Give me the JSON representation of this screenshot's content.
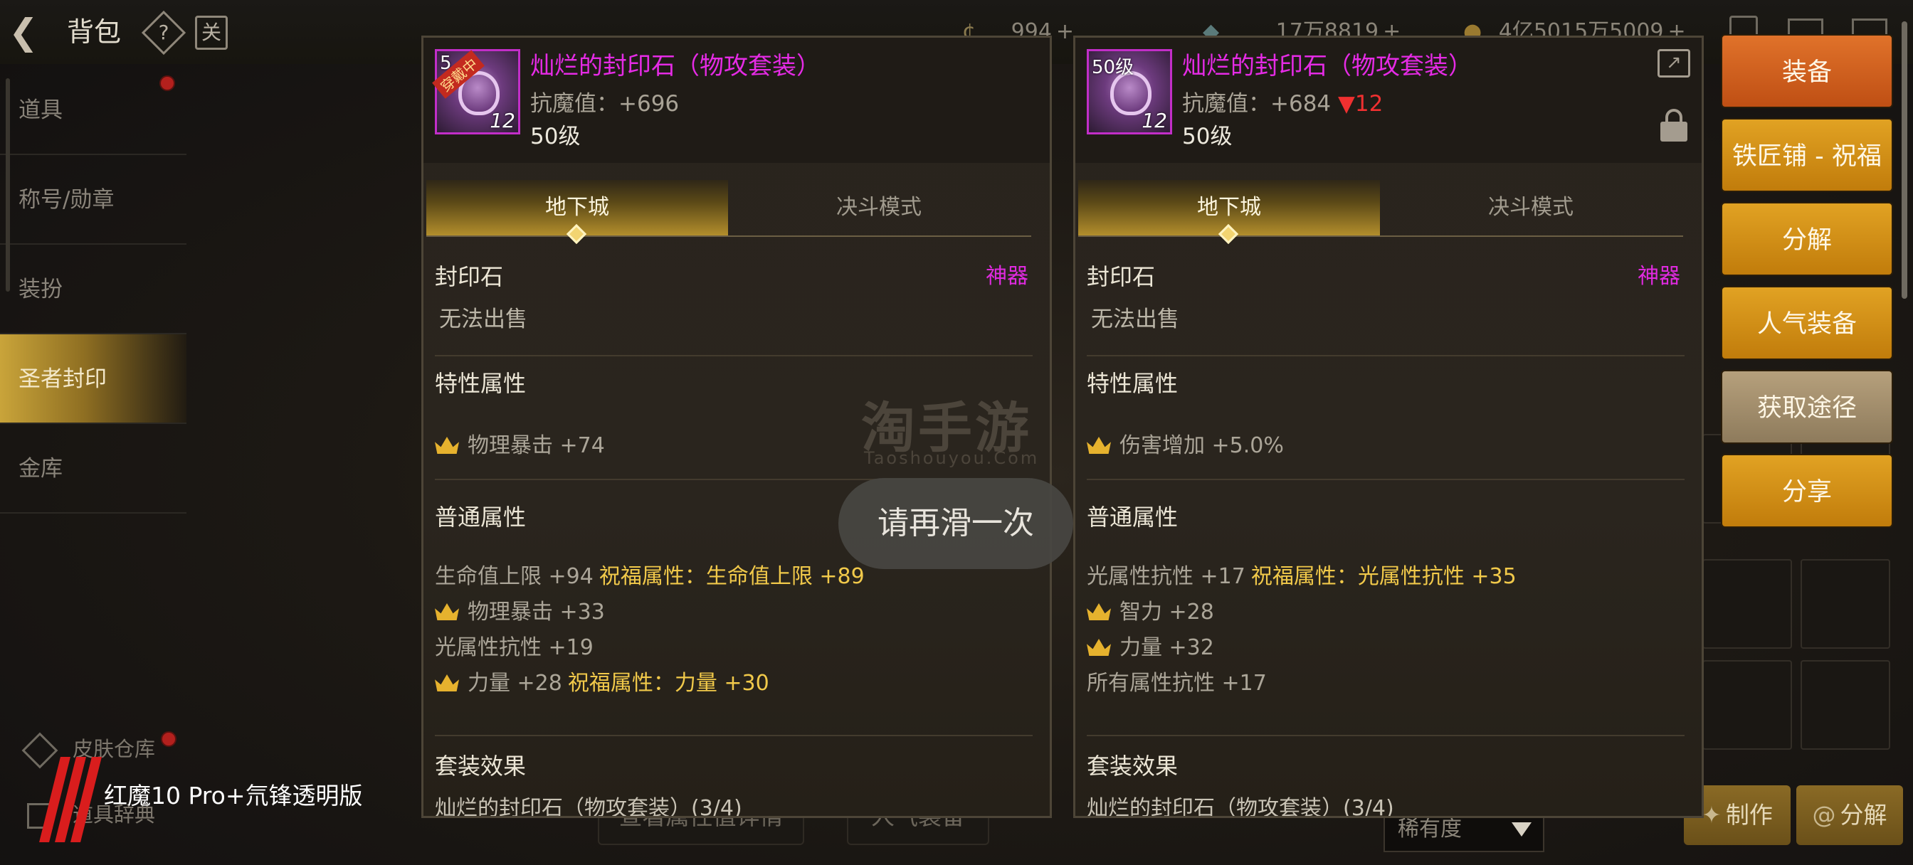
{
  "header": {
    "title": "背包",
    "help_glyph": "?",
    "calendar_glyph": "关",
    "currencies": [
      {
        "icon": "coin-icon",
        "value": "994"
      },
      {
        "icon": "gem-icon",
        "value": "17万8819"
      },
      {
        "icon": "gold-icon",
        "value": "4亿5015万5009"
      }
    ],
    "plus": "+"
  },
  "sidebar": {
    "items": [
      {
        "label": "道具"
      },
      {
        "label": "称号/勋章"
      },
      {
        "label": "装扮"
      },
      {
        "label": "圣者封印"
      },
      {
        "label": "金库"
      }
    ],
    "lower_items": [
      {
        "label": "皮肤仓库"
      },
      {
        "label": "道具辞典"
      }
    ]
  },
  "left_panel": {
    "icon_level": "5",
    "icon_ribbon": "穿戴中",
    "icon_count": "12",
    "name": "灿烂的封印石（物攻套装）",
    "stat_label": "抗魔值：+696",
    "level": "50级",
    "tabs": [
      "地下城",
      "决斗模式"
    ],
    "category": "封印石",
    "rarity": "神器",
    "sell": "无法出售",
    "trait_title": "特性属性",
    "trait": "物理暴击 +74",
    "normal_title": "普通属性",
    "normal_attrs": [
      {
        "text": "生命值上限 +94",
        "bless": "祝福属性：生命值上限 +89",
        "crown": false
      },
      {
        "text": "物理暴击 +33",
        "bless": "",
        "crown": true
      },
      {
        "text": "光属性抗性 +19",
        "bless": "",
        "crown": false
      },
      {
        "text": "力量 +28",
        "bless": "祝福属性：力量 +30",
        "crown": true
      }
    ],
    "set_title": "套装效果",
    "set_name": "灿烂的封印石（物攻套装）(3/4)"
  },
  "right_panel": {
    "icon_level": "50级",
    "icon_count": "12",
    "name": "灿烂的封印石（物攻套装）",
    "stat_label": "抗魔值：+684",
    "stat_delta": "▼12",
    "level": "50级",
    "tabs": [
      "地下城",
      "决斗模式"
    ],
    "category": "封印石",
    "rarity": "神器",
    "sell": "无法出售",
    "trait_title": "特性属性",
    "trait": "伤害增加 +5.0%",
    "normal_title": "普通属性",
    "normal_attrs": [
      {
        "text": "光属性抗性 +17",
        "bless": "祝福属性：光属性抗性 +35",
        "crown": false
      },
      {
        "text": "智力 +28",
        "bless": "",
        "crown": true
      },
      {
        "text": "力量 +32",
        "bless": "",
        "crown": true
      },
      {
        "text": "所有属性抗性 +17",
        "bless": "",
        "crown": false
      }
    ],
    "set_title": "套装效果",
    "set_name": "灿烂的封印石（物攻套装）(3/4)"
  },
  "actions": [
    {
      "label": "装备",
      "style": "orange"
    },
    {
      "label": "铁匠铺 - 祝福",
      "style": "gold"
    },
    {
      "label": "分解",
      "style": "gold"
    },
    {
      "label": "人气装备",
      "style": "gold"
    },
    {
      "label": "获取途径",
      "style": "grey"
    },
    {
      "label": "分享",
      "style": "gold"
    }
  ],
  "bottom": {
    "craft": "制作",
    "decompose": "分解",
    "sort_select": "稀有度",
    "left_btn_1": "查看属性值详情",
    "left_btn_2": "人气装备"
  },
  "toast": "请再滑一次",
  "watermark": {
    "big": "淘手游",
    "small": "Taoshouyou.Com"
  },
  "device_brand": "红魔10 Pro+氘锋透明版",
  "colors": {
    "epic_purple": "#e52be5",
    "bless_gold": "#f1c94a",
    "delta_red": "#f03030",
    "btn_orange": "#d3621f",
    "btn_gold": "#d4901a"
  }
}
